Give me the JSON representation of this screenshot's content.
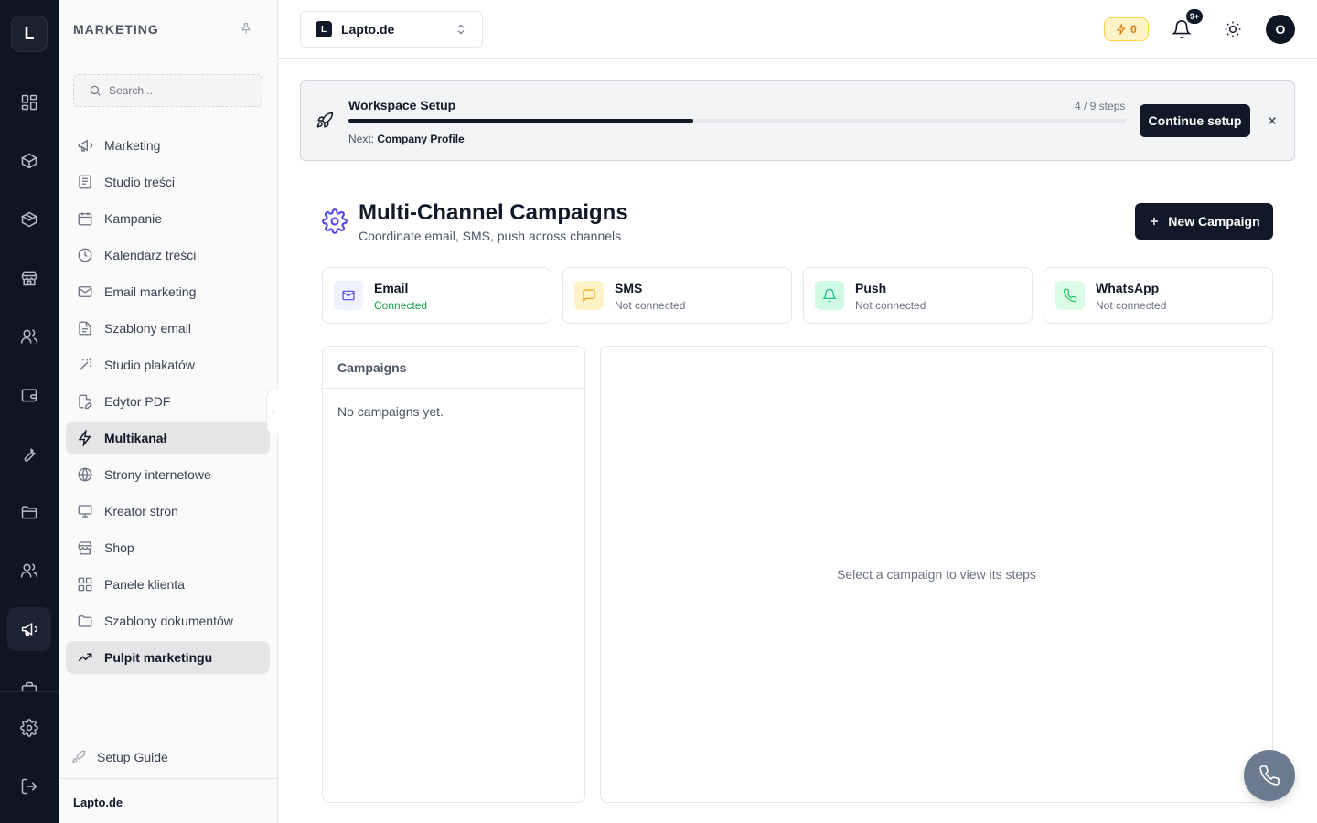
{
  "rail": {
    "logo": "L",
    "icons": [
      "dashboard-icon",
      "box-icon",
      "package-icon",
      "store-icon",
      "users-icon",
      "wallet-icon",
      "wrench-icon",
      "folder-icon",
      "team-icon",
      "megaphone-icon",
      "briefcase-icon",
      "settings-icon",
      "logout-icon"
    ],
    "active": "megaphone-icon"
  },
  "sidebar": {
    "title": "MARKETING",
    "search_placeholder": "Search...",
    "items": [
      {
        "label": "Marketing",
        "icon": "megaphone-icon"
      },
      {
        "label": "Studio treści",
        "icon": "newspaper-icon"
      },
      {
        "label": "Kampanie",
        "icon": "calendar-icon"
      },
      {
        "label": "Kalendarz treści",
        "icon": "clock-icon"
      },
      {
        "label": "Email marketing",
        "icon": "mail-icon"
      },
      {
        "label": "Szablony email",
        "icon": "file-text-icon"
      },
      {
        "label": "Studio plakatów",
        "icon": "magic-wand-icon"
      },
      {
        "label": "Edytor PDF",
        "icon": "file-edit-icon"
      },
      {
        "label": "Multikanał",
        "icon": "zap-icon",
        "active": true
      },
      {
        "label": "Strony internetowe",
        "icon": "globe-icon"
      },
      {
        "label": "Kreator stron",
        "icon": "monitor-icon"
      },
      {
        "label": "Shop",
        "icon": "store-icon"
      },
      {
        "label": "Panele klienta",
        "icon": "grid-icon"
      },
      {
        "label": "Szablony dokumentów",
        "icon": "folder-icon"
      },
      {
        "label": "Pulpit marketingu",
        "icon": "trending-up-icon",
        "active": true
      }
    ],
    "setup_guide": "Setup Guide",
    "footer": "Lapto.de"
  },
  "topbar": {
    "workspace_badge": "L",
    "workspace_name": "Lapto.de",
    "credits": "0",
    "notifications_badge": "9+",
    "avatar": "O"
  },
  "banner": {
    "title": "Workspace Setup",
    "steps": "4 / 9 steps",
    "progress_fraction": 0.444,
    "next_label": "Next:",
    "next_value": "Company Profile",
    "continue_label": "Continue setup"
  },
  "page": {
    "title": "Multi-Channel Campaigns",
    "subtitle": "Coordinate email, SMS, push across channels",
    "new_button": "New Campaign"
  },
  "channels": [
    {
      "name": "Email",
      "status": "Connected",
      "icon": "mail-icon",
      "color": "#4f46e5",
      "bg": "#eef2ff",
      "status_color": "#16a34a"
    },
    {
      "name": "SMS",
      "status": "Not connected",
      "icon": "message-square-icon",
      "color": "#f59e0b",
      "bg": "#fef3c7",
      "status_color": "#6b7280"
    },
    {
      "name": "Push",
      "status": "Not connected",
      "icon": "bell-icon",
      "color": "#10b981",
      "bg": "#d1fae5",
      "status_color": "#6b7280"
    },
    {
      "name": "WhatsApp",
      "status": "Not connected",
      "icon": "phone-icon",
      "color": "#22c55e",
      "bg": "#dcfce7",
      "status_color": "#6b7280"
    }
  ],
  "campaigns": {
    "header": "Campaigns",
    "empty": "No campaigns yet.",
    "detail_empty": "Select a campaign to view its steps"
  },
  "colors": {
    "rail_bg": "#0f1623",
    "accent": "#111827",
    "brand_icon": "#4f46e5"
  }
}
